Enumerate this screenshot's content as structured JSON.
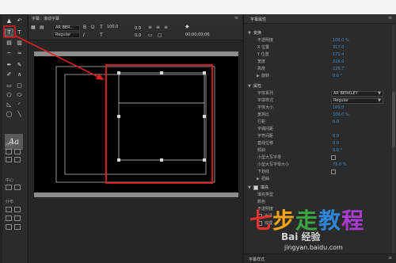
{
  "window": {
    "title": "字幕：滚动字幕"
  },
  "text_toolbar": {
    "font_family": "AR BER...",
    "font_style": "Regular",
    "font_size": "100.0",
    "aux_value_a": "0.0",
    "aux_value_b": "0.0",
    "timecode": "00;00;09;06"
  },
  "left_tools": {
    "align_label": "对齐",
    "center_label": "中心",
    "distribute_label": "分布",
    "style_glyph": "Aa"
  },
  "properties": {
    "title": "字幕属性",
    "bottom_panel_title": "字幕样式",
    "sections": [
      {
        "kind": "head",
        "label": "变换"
      },
      {
        "kind": "value",
        "label": "不透明度",
        "value": "100.0 %"
      },
      {
        "kind": "value",
        "label": "X 位置",
        "value": "317.0"
      },
      {
        "kind": "value",
        "label": "Y 位置",
        "value": "171.4"
      },
      {
        "kind": "value",
        "label": "宽度",
        "value": "216.0"
      },
      {
        "kind": "value",
        "label": "高度",
        "value": "226.7"
      },
      {
        "kind": "sub",
        "label": "旋转",
        "value": "0.0 °"
      },
      {
        "kind": "head",
        "label": "属性"
      },
      {
        "kind": "dropdown",
        "label": "字体系列",
        "value": "AR BERKLEY"
      },
      {
        "kind": "dropdown",
        "label": "字体样式",
        "value": "Regular"
      },
      {
        "kind": "value",
        "label": "字体大小",
        "value": "100.0"
      },
      {
        "kind": "value",
        "label": "宽高比",
        "value": "100.0 %"
      },
      {
        "kind": "value",
        "label": "行距",
        "value": "0.0"
      },
      {
        "kind": "value",
        "label": "字偶间距",
        "value": ""
      },
      {
        "kind": "value",
        "label": "字符间距",
        "value": "0.0"
      },
      {
        "kind": "value",
        "label": "基线位移",
        "value": "0.0"
      },
      {
        "kind": "value",
        "label": "倾斜",
        "value": "0.0 °"
      },
      {
        "kind": "check",
        "label": "小型大写字母",
        "checked": false
      },
      {
        "kind": "value",
        "label": "小型大写字母大小",
        "value": "75.0 %"
      },
      {
        "kind": "check",
        "label": "下划线",
        "checked": false
      },
      {
        "kind": "sub",
        "label": "扭曲",
        "value": ""
      },
      {
        "kind": "headcheck",
        "label": "填充",
        "checked": true
      },
      {
        "kind": "value",
        "label": "填充类型",
        "value": ""
      },
      {
        "kind": "value",
        "label": "颜色",
        "value": ""
      },
      {
        "kind": "value",
        "label": "不透明度",
        "value": ""
      },
      {
        "kind": "check",
        "label": "光泽",
        "checked": false
      },
      {
        "kind": "check",
        "label": "纹理",
        "checked": false
      }
    ]
  },
  "watermark": {
    "chars": [
      "七",
      "步",
      "走",
      "教",
      "程"
    ],
    "brand": "Bai 经验",
    "url": "jingyan.baidu.com"
  },
  "colors": {
    "accent_blue": "#3e8fd9",
    "annotation_red": "#e0201c",
    "panel_bg": "#2b2b2b"
  }
}
